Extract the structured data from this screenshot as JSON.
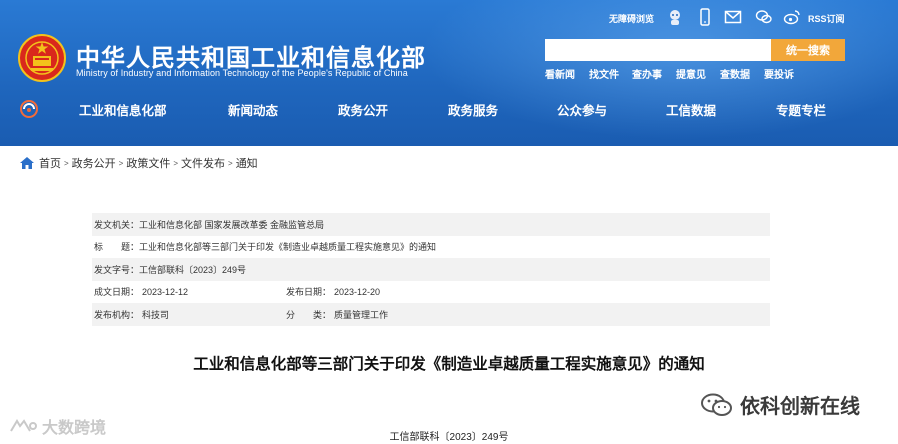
{
  "header": {
    "title": "中华人民共和国工业和信息化部",
    "subtitle": "Ministry of Industry and Information Technology of the People's Republic of China",
    "accessibility_label": "无障碍浏览",
    "rss_label": "RSS订阅",
    "search": {
      "placeholder": "",
      "button": "统一搜索"
    },
    "quick_links": [
      "看新闻",
      "找文件",
      "查办事",
      "提意见",
      "查数据",
      "要投诉"
    ]
  },
  "nav": {
    "items": [
      "工业和信息化部",
      "新闻动态",
      "政务公开",
      "政务服务",
      "公众参与",
      "工信数据",
      "专题专栏"
    ]
  },
  "breadcrumb": [
    "首页",
    "政务公开",
    "政策文件",
    "文件发布",
    "通知"
  ],
  "meta": {
    "issuer_label": "发文机关：",
    "issuer_value": "工业和信息化部 国家发展改革委 金融监管总局",
    "title_label": "标　　题：",
    "title_value": "工业和信息化部等三部门关于印发《制造业卓越质量工程实施意见》的通知",
    "docno_label": "发文字号：",
    "docno_value": "工信部联科〔2023〕249号",
    "date_label": "成文日期：",
    "date_value": "2023-12-12",
    "pub_label": "发布日期：",
    "pub_value": "2023-12-20",
    "org_label": "发布机构：",
    "org_value": "科技司",
    "cat_label": "分　　类：",
    "cat_value": "质量管理工作"
  },
  "document": {
    "title": "工业和信息化部等三部门关于印发《制造业卓越质量工程实施意见》的通知",
    "number": "工信部联科〔2023〕249号"
  },
  "watermarks": {
    "left": "大数跨境",
    "right": "依科创新在线"
  },
  "colors": {
    "header_blue": "#1f66bd",
    "search_orange": "#f2a73a",
    "row_gray": "#f2f2f2"
  }
}
